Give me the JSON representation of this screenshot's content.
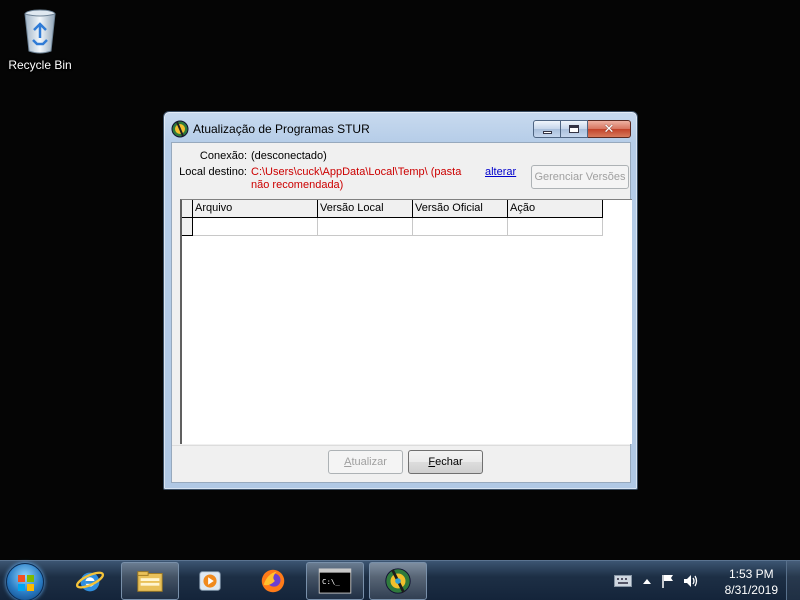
{
  "desktop": {
    "icons": [
      {
        "label": "Recycle Bin",
        "icon": "recycle-bin-icon"
      }
    ]
  },
  "window": {
    "title": "Atualização de Programas STUR",
    "connection_label": "Conexão:",
    "connection_value": "(desconectado)",
    "destination_label": "Local destino:",
    "destination_value": "C:\\Users\\cuck\\AppData\\Local\\Temp\\ (pasta não recomendada)",
    "change_link": "alterar",
    "manage_versions_button": "Gerenciar Versões",
    "table": {
      "columns": [
        "Arquivo",
        "Versão Local",
        "Versão Oficial",
        "Ação"
      ],
      "rows": [
        [
          "",
          "",
          "",
          ""
        ]
      ]
    },
    "update_button": {
      "prefix": "",
      "underline": "A",
      "rest": "tualizar",
      "enabled": false
    },
    "close_button": {
      "prefix": "",
      "underline": "F",
      "rest": "echar",
      "enabled": true
    }
  },
  "taskbar": {
    "items": [
      {
        "icon": "internet-explorer-icon"
      },
      {
        "icon": "file-explorer-icon"
      },
      {
        "icon": "media-player-icon"
      },
      {
        "icon": "firefox-icon"
      },
      {
        "icon": "command-prompt-icon",
        "text": "C:\\_"
      },
      {
        "icon": "stur-app-icon",
        "active": true
      }
    ],
    "clock": {
      "time": "1:53 PM",
      "date": "8/31/2019"
    }
  }
}
